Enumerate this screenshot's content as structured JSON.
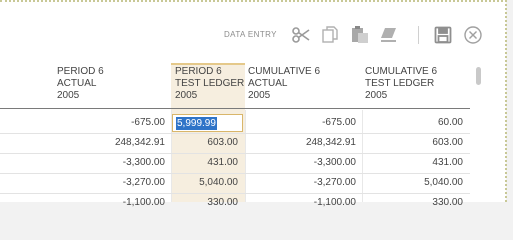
{
  "toolbar": {
    "label": "DATA ENTRY",
    "icons": [
      "scissors-icon",
      "copy-icon",
      "paste-icon",
      "clear-icon",
      "save-icon",
      "close-icon"
    ]
  },
  "table": {
    "columns": [
      {
        "line1": "PERIOD 6",
        "line2": "ACTUAL",
        "line3": "2005"
      },
      {
        "line1": "PERIOD 6",
        "line2": "TEST LEDGER",
        "line3": "2005"
      },
      {
        "line1": "CUMULATIVE 6",
        "line2": "ACTUAL",
        "line3": "2005"
      },
      {
        "line1": "CUMULATIVE 6",
        "line2": "TEST LEDGER",
        "line3": "2005"
      }
    ],
    "rows": [
      [
        "-675.00",
        "5,999.99",
        "-675.00",
        "60.00"
      ],
      [
        "248,342.91",
        "603.00",
        "248,342.91",
        "603.00"
      ],
      [
        "-3,300.00",
        "431.00",
        "-3,300.00",
        "431.00"
      ],
      [
        "-3,270.00",
        "5,040.00",
        "-3,270.00",
        "5,040.00"
      ],
      [
        "-1,100.00",
        "330.00",
        "-1,100.00",
        "330.00"
      ]
    ]
  },
  "colors": {
    "highlight_column": "#f6eedf",
    "edit_border": "#d9b66a",
    "selection": "#2f74c8"
  }
}
